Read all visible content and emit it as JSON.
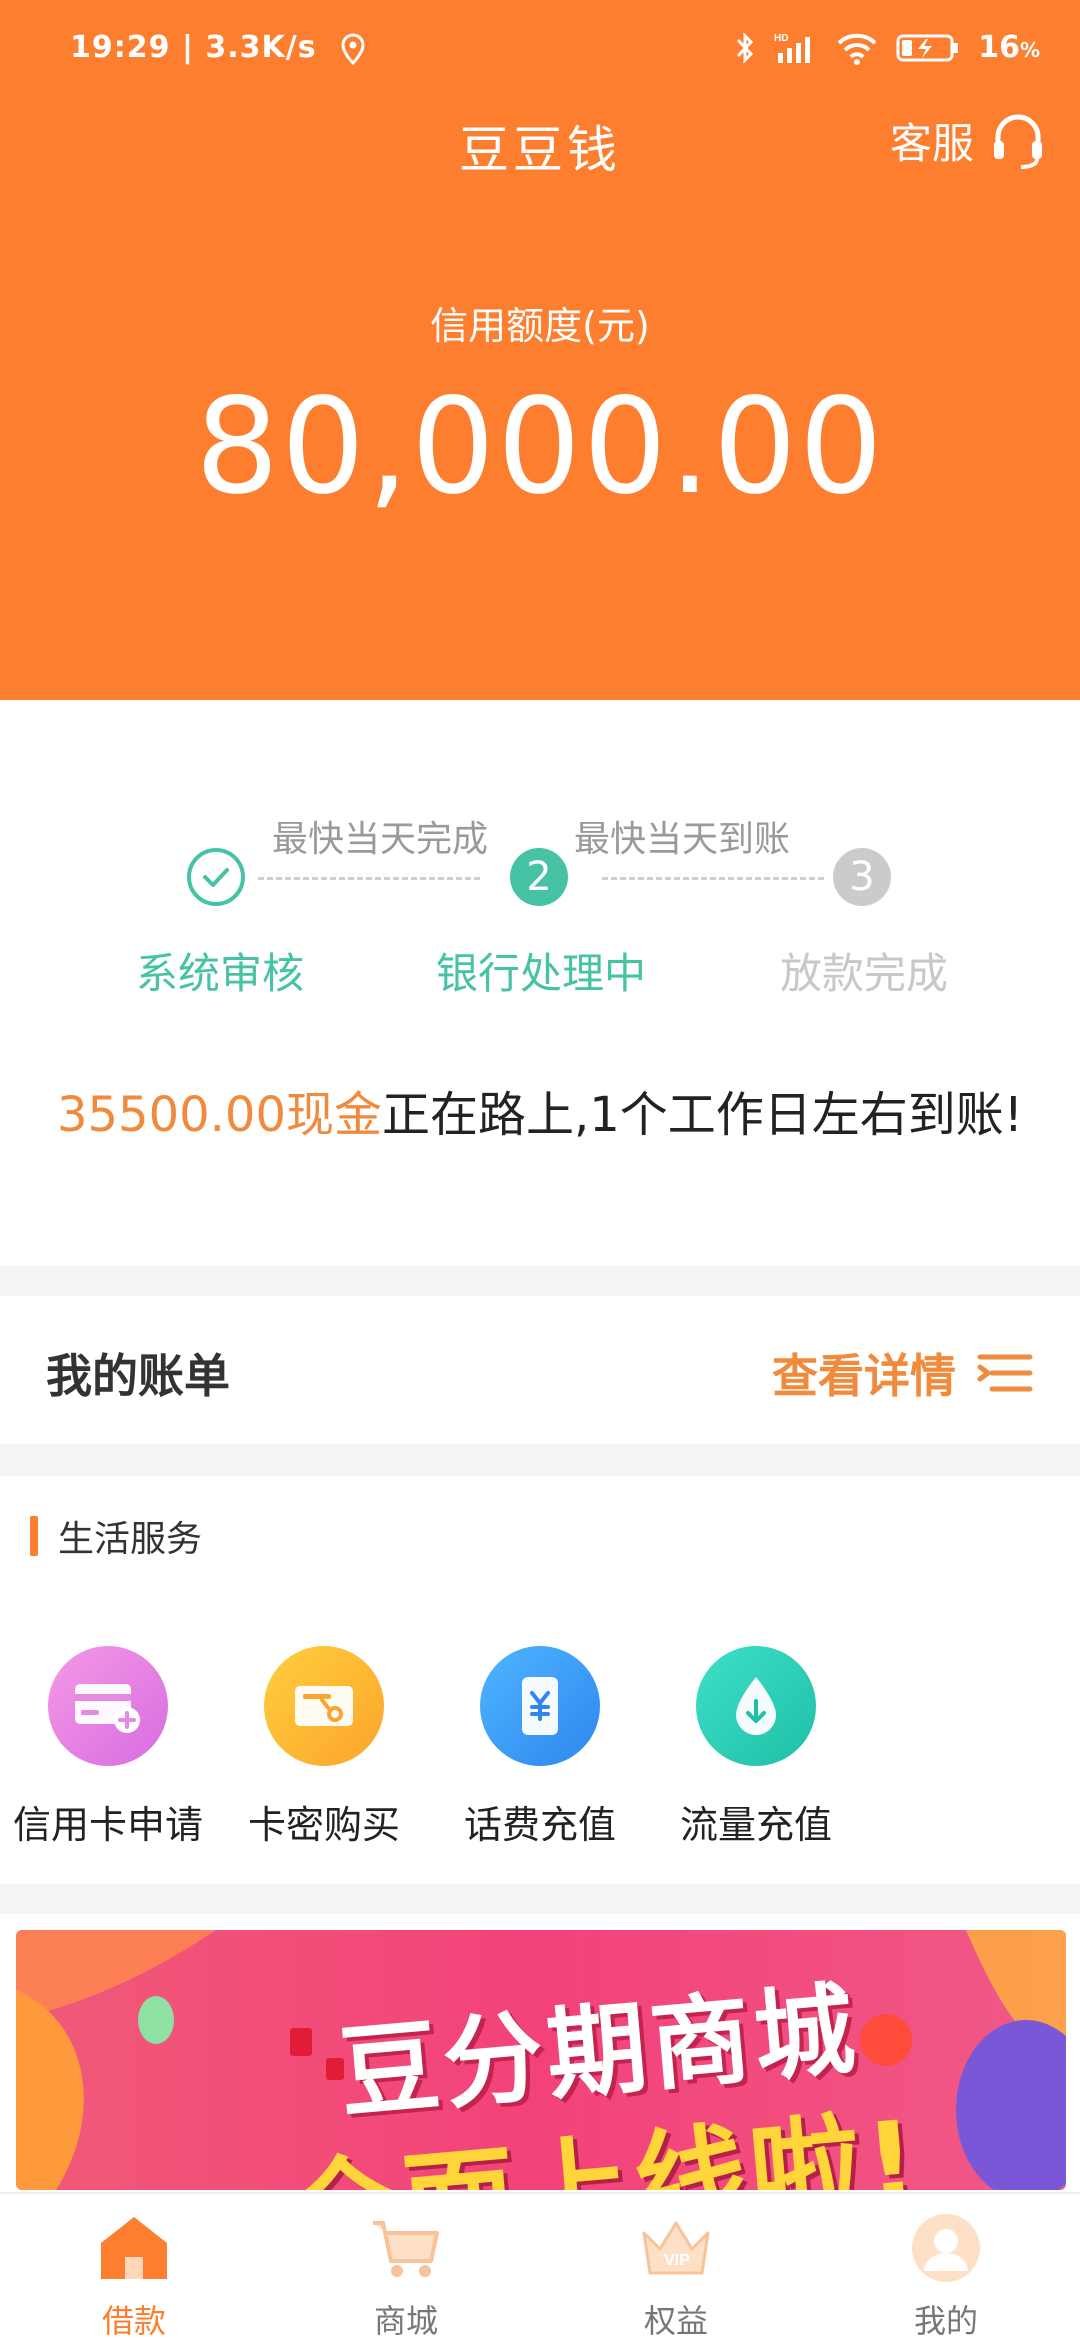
{
  "status_bar": {
    "time": "19:29",
    "speed": "3.3K/s",
    "battery": "16",
    "battery_unit": "%",
    "icons": [
      "location-icon",
      "bluetooth-icon",
      "hd-signal-icon",
      "wifi-icon",
      "battery-icon"
    ]
  },
  "header": {
    "title": "豆豆钱",
    "service_label": "客服",
    "credit_label": "信用额度(元)",
    "credit_amount": "80,000.00"
  },
  "progress": {
    "hints": [
      "最快当天完成",
      "最快当天到账"
    ],
    "steps": [
      {
        "label": "系统审核",
        "state": "done"
      },
      {
        "label": "银行处理中",
        "number": "2",
        "state": "current"
      },
      {
        "label": "放款完成",
        "number": "3",
        "state": "pending"
      }
    ],
    "notice_amount": "35500.00现金",
    "notice_text": "正在路上,1个工作日左右到账!"
  },
  "bill": {
    "title": "我的账单",
    "link": "查看详情"
  },
  "life_services": {
    "title": "生活服务",
    "items": [
      {
        "label": "信用卡申请",
        "icon": "credit-card-icon"
      },
      {
        "label": "卡密购买",
        "icon": "card-key-icon"
      },
      {
        "label": "话费充值",
        "icon": "yuan-phone-icon"
      },
      {
        "label": "流量充值",
        "icon": "data-drop-icon"
      }
    ]
  },
  "banner": {
    "line1": "豆分期商城",
    "line2": "全面上线啦!"
  },
  "nav": {
    "items": [
      {
        "label": "借款",
        "icon": "home-icon",
        "active": true
      },
      {
        "label": "商城",
        "icon": "cart-icon"
      },
      {
        "label": "权益",
        "icon": "vip-crown-icon"
      },
      {
        "label": "我的",
        "icon": "avatar-icon"
      }
    ]
  },
  "colors": {
    "brand": "#fd7e2f",
    "teal": "#46c2a5",
    "highlight": "#f08a3c"
  }
}
